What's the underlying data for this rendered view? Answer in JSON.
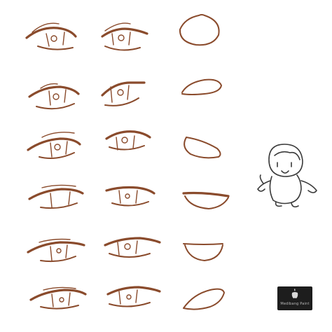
{
  "sheet": {
    "eye_rows": 6,
    "columns": [
      "left-eye",
      "right-eye",
      "mouth"
    ],
    "stroke_color": "#8a4b2c",
    "background": "#ffffff"
  },
  "watermark": {
    "icon": "apple-logo-icon",
    "label": "Medibang Paint",
    "background": "#1d1d1d"
  },
  "character": {
    "description_icon": "chibi-character-icon",
    "line_color": "#3a3a3a"
  }
}
